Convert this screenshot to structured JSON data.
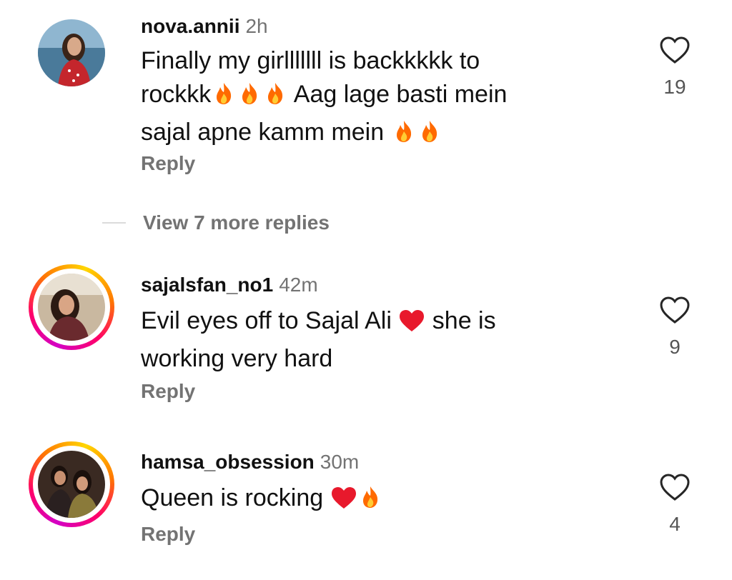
{
  "comments": [
    {
      "username": "nova.annii",
      "time": "2h",
      "text_line1": "Finally my girlllllll is backkkkk to",
      "text_line2a": "rockkk",
      "text_line2b": " Aag lage basti mein",
      "text_line3": "sajal apne kamm mein ",
      "reply": "Reply",
      "likes": "19",
      "avatar_icon": "profile-photo"
    },
    {
      "username": "sajalsfan_no1",
      "time": "42m",
      "text_line1a": "Evil eyes off to Sajal Ali ",
      "text_line1b": " she is",
      "text_line2": "working very hard",
      "reply": "Reply",
      "likes": "9",
      "avatar_icon": "profile-photo-story-ring"
    },
    {
      "username": "hamsa_obsession",
      "time": "30m",
      "text": "Queen is rocking ",
      "reply": "Reply",
      "likes": "4",
      "avatar_icon": "profile-photo-story-ring"
    }
  ],
  "view_more": "View 7 more replies",
  "colors": {
    "secondary_text": "#737373",
    "heart_stroke": "#262626",
    "fire": "#ff6a00",
    "heart_emoji": "#e8192c"
  }
}
